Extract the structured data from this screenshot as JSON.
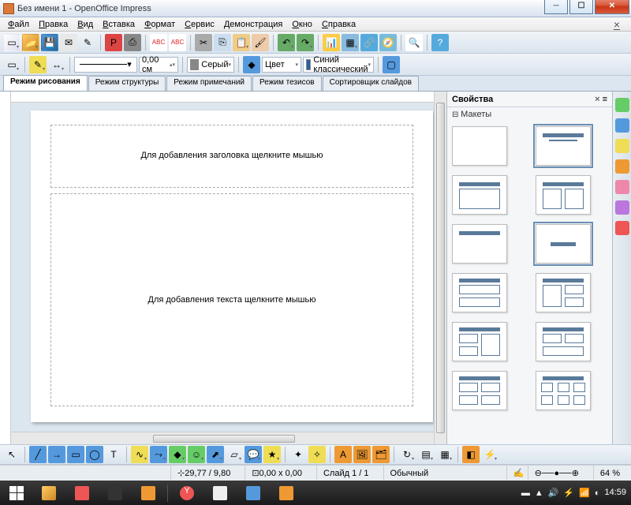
{
  "window": {
    "title": "Без имени 1 - OpenOffice Impress"
  },
  "menu": {
    "items": [
      "Файл",
      "Правка",
      "Вид",
      "Вставка",
      "Формат",
      "Сервис",
      "Демонстрация",
      "Окно",
      "Справка"
    ]
  },
  "linebar": {
    "width_value": "0,00 см",
    "color1_label": "Серый",
    "fill_label": "Цвет",
    "color2_label": "Синий классический"
  },
  "viewtabs": {
    "items": [
      "Режим рисования",
      "Режим структуры",
      "Режим примечаний",
      "Режим тезисов",
      "Сортировщик слайдов"
    ],
    "active": 0
  },
  "slide": {
    "title_placeholder": "Для добавления заголовка щелкните мышью",
    "body_placeholder": "Для добавления текста щелкните мышью"
  },
  "sidebar": {
    "title": "Свойства",
    "section": "Макеты"
  },
  "status": {
    "pos": "29,77 / 9,80",
    "size": "0,00 x 0,00",
    "slide": "Слайд 1 / 1",
    "template": "Обычный",
    "zoom": "64 %"
  },
  "taskbar": {
    "time": "14:59",
    "date": "14:59"
  },
  "colors": {
    "sidebar_layout_bar": "#5a7a9a"
  }
}
